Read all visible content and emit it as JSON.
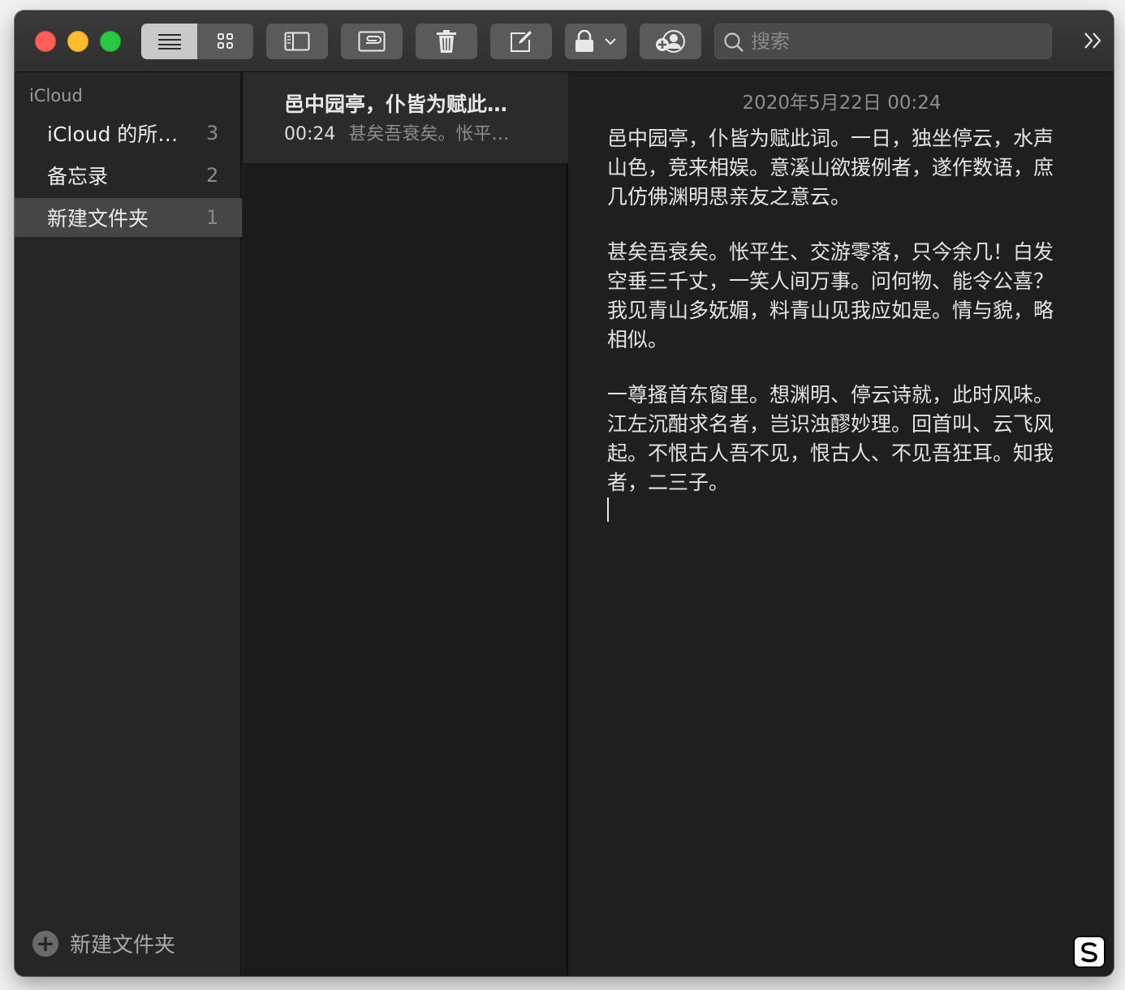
{
  "toolbar": {
    "search_placeholder": "搜索"
  },
  "sidebar": {
    "account": "iCloud",
    "folders": [
      {
        "name": "iCloud 的所…",
        "count": "3"
      },
      {
        "name": "备忘录",
        "count": "2"
      },
      {
        "name": "新建文件夹",
        "count": "1"
      }
    ],
    "new_folder_label": "新建文件夹"
  },
  "notes": [
    {
      "title": "邑中园亭，仆皆为赋此…",
      "time": "00:24",
      "snippet": "甚矣吾衰矣。怅平…"
    }
  ],
  "editor": {
    "date": "2020年5月22日 00:24",
    "paragraphs": [
      "邑中园亭，仆皆为赋此词。一日，独坐停云，水声山色，竞来相娱。意溪山欲援例者，遂作数语，庶几仿佛渊明思亲友之意云。",
      "甚矣吾衰矣。怅平生、交游零落，只今余几！白发空垂三千丈，一笑人间万事。问何物、能令公喜？我见青山多妩媚，料青山见我应如是。情与貌，略相似。",
      "一尊搔首东窗里。想渊明、停云诗就，此时风味。江左沉酣求名者，岂识浊醪妙理。回首叫、云飞风起。不恨古人吾不见，恨古人、不见吾狂耳。知我者，二三子。"
    ]
  }
}
